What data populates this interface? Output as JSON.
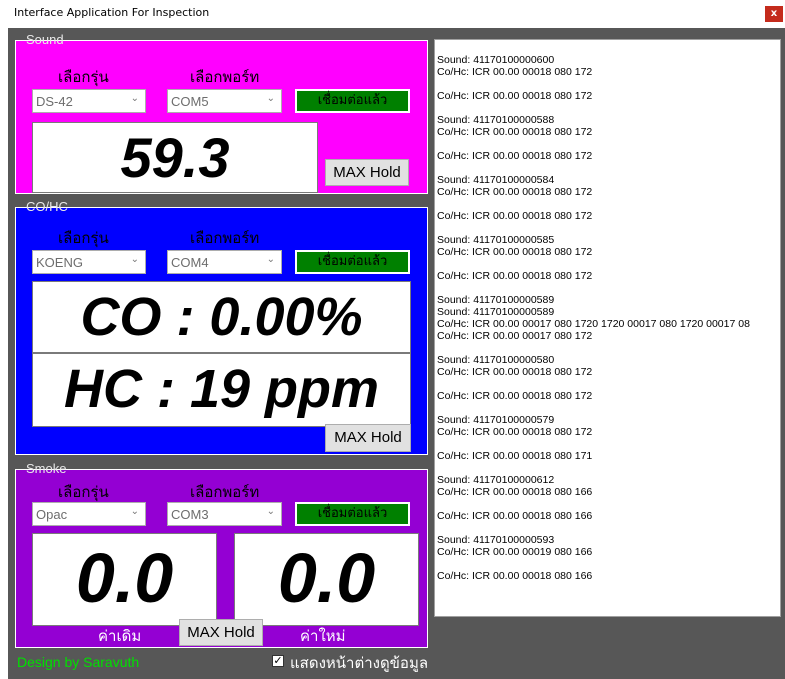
{
  "window": {
    "title": "Interface Application For Inspection",
    "close_glyph": "x"
  },
  "sound": {
    "legend": "Sound",
    "model_label": "เลือกรุ่น",
    "port_label": "เลือกพอร์ท",
    "model_value": "DS-42",
    "port_value": "COM5",
    "connect_label": "เชื่อมต่อแล้ว",
    "reading": "59.3",
    "max_hold": "MAX Hold",
    "bg_color": "#ff00ff"
  },
  "cohc": {
    "legend": "CO/HC",
    "model_label": "เลือกรุ่น",
    "port_label": "เลือกพอร์ท",
    "model_value": "KOENG",
    "port_value": "COM4",
    "connect_label": "เชื่อมต่อแล้ว",
    "co_reading": "CO : 0.00%",
    "hc_reading": "HC : 19 ppm",
    "max_hold": "MAX Hold",
    "bg_color": "#0000ff"
  },
  "smoke": {
    "legend": "Smoke",
    "model_label": "เลือกรุ่น",
    "port_label": "เลือกพอร์ท",
    "model_value": "Opac",
    "port_value": "COM3",
    "connect_label": "เชื่อมต่อแล้ว",
    "old_reading": "0.0",
    "new_reading": "0.0",
    "old_label": "ค่าเดิม",
    "new_label": "ค่าใหม่",
    "max_hold": "MAX Hold",
    "bg_color": "#9400d3"
  },
  "log": {
    "lines": [
      "Sound:  41170100000600",
      "Co/Hc: ICR 00.00 00018 080 172",
      "",
      "Co/Hc: ICR 00.00 00018 080 172",
      "",
      "Sound:  41170100000588",
      "Co/Hc: ICR 00.00 00018 080 172",
      "",
      "Co/Hc: ICR 00.00 00018 080 172",
      "",
      "Sound:  41170100000584",
      "Co/Hc: ICR 00.00 00018 080 172",
      "",
      "Co/Hc: ICR 00.00 00018 080 172",
      "",
      "Sound:  41170100000585",
      "Co/Hc: ICR 00.00 00018 080 172",
      "",
      "Co/Hc: ICR 00.00 00018 080 172",
      "",
      "Sound:  41170100000589",
      "Sound:  41170100000589",
      "Co/Hc: ICR 00.00 00017 080 1720 1720 00017 080 1720 00017 08",
      "Co/Hc: ICR 00.00 00017 080 172",
      "",
      "Sound:  41170100000580",
      "Co/Hc: ICR 00.00 00018 080 172",
      "",
      "Co/Hc: ICR 00.00 00018 080 172",
      "",
      "Sound:  41170100000579",
      "Co/Hc: ICR 00.00 00018 080 172",
      "",
      "Co/Hc: ICR 00.00 00018 080 171",
      "",
      "Sound:  41170100000612",
      "Co/Hc: ICR 00.00 00018 080 166",
      "",
      "Co/Hc: ICR 00.00 00018 080 166",
      "",
      "Sound:  41170100000593",
      "Co/Hc: ICR 00.00 00019 080 166",
      "",
      "Co/Hc: ICR 00.00 00018 080 166"
    ]
  },
  "footer": {
    "credit": "Design by Saravuth",
    "show_window_label": "แสดงหน้าต่างดูข้อมูล",
    "show_window_checked": true
  },
  "icons": {
    "dropdown": "chevron-down-icon",
    "check": "checkmark-icon",
    "close": "close-icon"
  }
}
